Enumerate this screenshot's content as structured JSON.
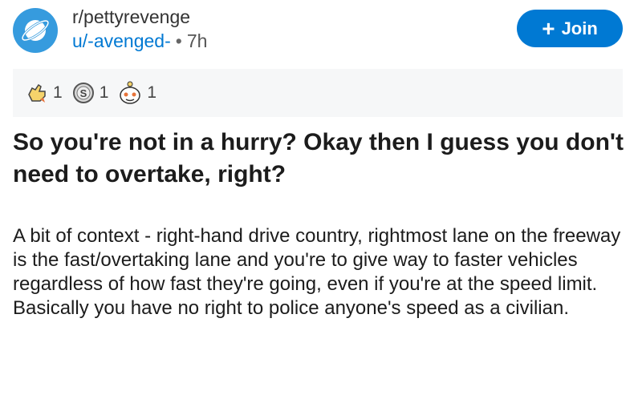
{
  "post": {
    "subreddit": "r/pettyrevenge",
    "author": "u/-avenged-",
    "separator": "•",
    "age": "7h",
    "join_label": "Join",
    "join_icon": "+",
    "awards": [
      {
        "name": "wholesome-award",
        "count": "1"
      },
      {
        "name": "silver-award",
        "count": "1"
      },
      {
        "name": "helpful-award",
        "count": "1"
      }
    ],
    "title": "So you're not in a hurry? Okay then I guess you don't need to overtake, right?",
    "body": "A bit of context - right-hand drive country, rightmost lane on the freeway is the fast/overtaking lane and you're to give way to faster vehicles regardless of how fast they're going, even if you're at the speed limit. Basically you have no right to police anyone's speed as a civilian."
  },
  "colors": {
    "accent": "#0079d3",
    "avatar": "#369bde",
    "awards_bg": "#f6f7f8"
  }
}
